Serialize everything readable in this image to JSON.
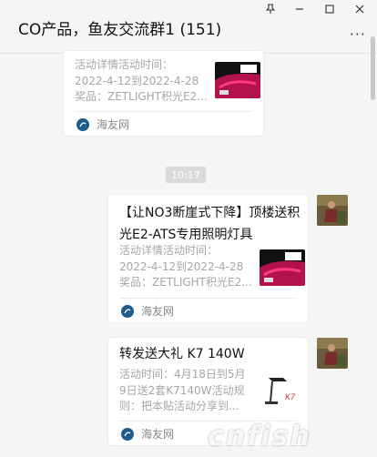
{
  "window": {
    "title": "CO产品，鱼友交流群1 (151)",
    "pin_icon": "pin-icon",
    "minimize_icon": "minimize-icon",
    "maximize_icon": "maximize-icon",
    "close_icon": "close-icon",
    "more_icon": "more-icon",
    "more_label": "···"
  },
  "messages": [
    {
      "title": "",
      "desc": "活动详情活动时间：\n2022-4-12到2022-4-28\n奖品：ZETLIGHT积光E2...",
      "source": "海友网"
    },
    {
      "title": "【让NO3断崖式下降】顶楼送积光E2-ATS专用照明灯具",
      "desc": "活动详情活动时间：\n2022-4-12到2022-4-28\n奖品：ZETLIGHT积光E2...",
      "source": "海友网"
    },
    {
      "title": "转发送大礼 K7 140W",
      "desc": "活动时间：4月18日到5月\n9日送2套K7140W活动规\n则：把本贴活动分享到...",
      "source": "海友网"
    }
  ],
  "timestamp": "10:17",
  "watermark": "cnfish"
}
